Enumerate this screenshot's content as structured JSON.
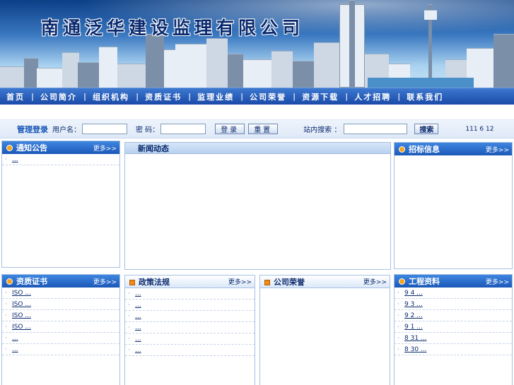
{
  "header": {
    "company_name": "南通泛华建设监理有限公司"
  },
  "nav": {
    "items": [
      "首页",
      "公司简介",
      "组织机构",
      "资质证书",
      "监理业绩",
      "公司荣誉",
      "资源下载",
      "人才招聘",
      "联系我们"
    ]
  },
  "login": {
    "title": "管理登录",
    "username_label": "用户名：",
    "password_label": "密 码：",
    "login_button": "登录",
    "reset_button": "重置",
    "search_label": "站内搜索 ：",
    "search_button": "搜索",
    "counter": "111 6 12"
  },
  "notice": {
    "title": "通知公告",
    "more": "更多>>",
    "items": [
      "..."
    ]
  },
  "news": {
    "title": "新闻动态"
  },
  "bidding": {
    "title": "招标信息",
    "more": "更多>>"
  },
  "certs": {
    "title": "资质证书",
    "more": "更多>>",
    "items": [
      "ISO ...",
      "ISO ...",
      "ISO ...",
      "ISO ...",
      "...",
      "..."
    ]
  },
  "policy": {
    "title": "政策法规",
    "more": "更多>>",
    "items": [
      "...",
      "...",
      "...",
      "...",
      "...",
      "..."
    ]
  },
  "honor": {
    "title": "公司荣誉",
    "more": "更多>>"
  },
  "projects": {
    "title": "工程资料",
    "more": "更多>>",
    "items": [
      "9 4 ...",
      "9 3 ...",
      "9 2 ...",
      "9 1 ...",
      "8 31 ...",
      "8 30 ..."
    ]
  },
  "colors": {
    "nav_bg": "#1a4aa8",
    "accent_orange": "#f7a21b",
    "text_blue": "#0a2a6e"
  }
}
